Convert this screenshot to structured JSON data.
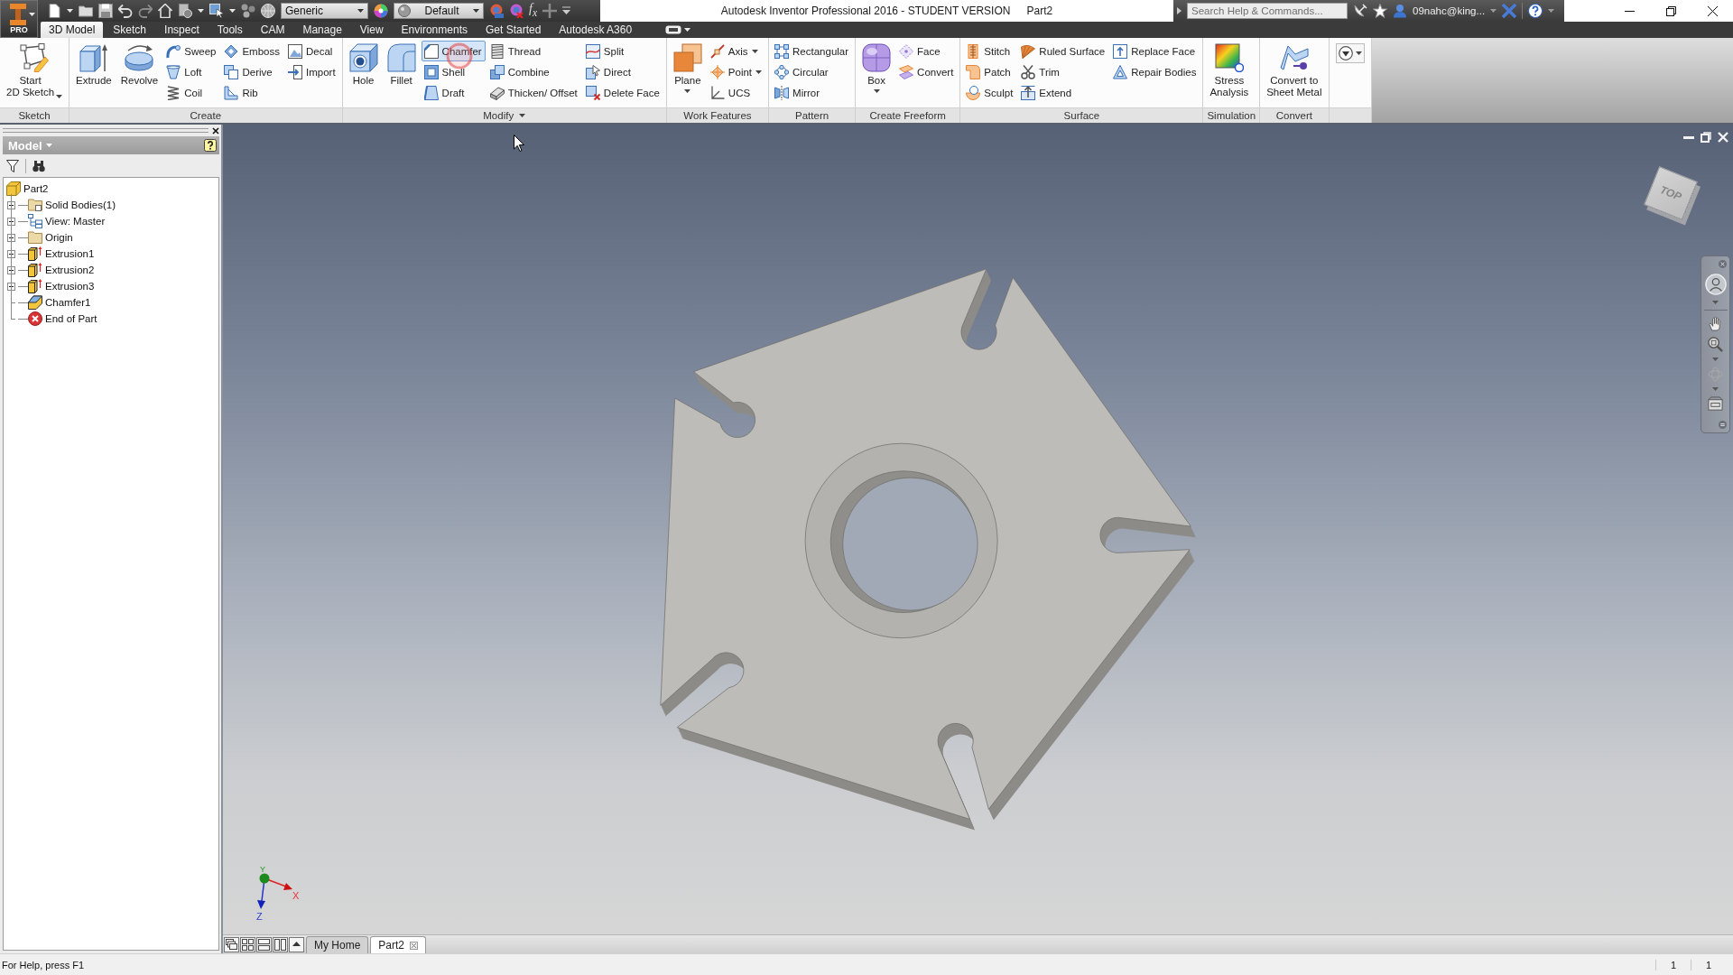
{
  "app_button": {
    "label": "PRO"
  },
  "quick_access": {
    "material": "Generic",
    "appearance": "Default",
    "function": "f$_{x}$"
  },
  "title_bar": {
    "title": "Autodesk Inventor Professional 2016 - STUDENT VERSION",
    "document": "Part2",
    "search": {
      "placeholder": "Search Help & Commands..."
    },
    "user": "09nahc@king..."
  },
  "ribbon_tabs": [
    {
      "label": "3D Model",
      "selected": true
    },
    {
      "label": "Sketch",
      "selected": false
    },
    {
      "label": "Inspect",
      "selected": false
    },
    {
      "label": "Tools",
      "selected": false
    },
    {
      "label": "CAM",
      "selected": false
    },
    {
      "label": "Manage",
      "selected": false
    },
    {
      "label": "View",
      "selected": false
    },
    {
      "label": "Environments",
      "selected": false
    },
    {
      "label": "Get Started",
      "selected": false
    },
    {
      "label": "Autodesk A360",
      "selected": false
    }
  ],
  "ribbon_panels": [
    {
      "label": "Sketch",
      "menu": false,
      "groups": [
        {
          "kind": "inline",
          "tools": [
            {
              "label": "Start\n2D Sketch",
              "dropdown": true,
              "highlighted": false
            }
          ]
        }
      ]
    },
    {
      "label": "Create",
      "menu": false,
      "groups": [
        {
          "kind": "large",
          "tools": [
            {
              "label": "Extrude",
              "dropdown": false,
              "highlighted": false
            }
          ]
        },
        {
          "kind": "large",
          "tools": [
            {
              "label": "Revolve",
              "dropdown": false,
              "highlighted": false
            }
          ]
        },
        {
          "kind": "small",
          "tools": [
            {
              "label": "Sweep",
              "dropdown": false,
              "highlighted": false
            },
            {
              "label": "Loft",
              "dropdown": false,
              "highlighted": false
            },
            {
              "label": "Coil",
              "dropdown": false,
              "highlighted": false
            }
          ]
        },
        {
          "kind": "small",
          "tools": [
            {
              "label": "Emboss",
              "dropdown": false,
              "highlighted": false
            },
            {
              "label": "Derive",
              "dropdown": false,
              "highlighted": false
            },
            {
              "label": "Rib",
              "dropdown": false,
              "highlighted": false
            }
          ]
        },
        {
          "kind": "small",
          "tools": [
            {
              "label": "Decal",
              "dropdown": false,
              "highlighted": false
            },
            {
              "label": "Import",
              "dropdown": false,
              "highlighted": false
            }
          ]
        }
      ]
    },
    {
      "label": "Modify",
      "menu": true,
      "groups": [
        {
          "kind": "large",
          "tools": [
            {
              "label": "Hole",
              "dropdown": false,
              "highlighted": false
            }
          ]
        },
        {
          "kind": "large",
          "tools": [
            {
              "label": "Fillet",
              "dropdown": false,
              "highlighted": false
            }
          ]
        },
        {
          "kind": "small",
          "tools": [
            {
              "label": "Chamfer",
              "dropdown": false,
              "highlighted": true
            },
            {
              "label": "Shell",
              "dropdown": false,
              "highlighted": false
            },
            {
              "label": "Draft",
              "dropdown": false,
              "highlighted": false
            }
          ]
        },
        {
          "kind": "small",
          "tools": [
            {
              "label": "Thread",
              "dropdown": false,
              "highlighted": false
            },
            {
              "label": "Combine",
              "dropdown": false,
              "highlighted": false
            },
            {
              "label": "Thicken/ Offset",
              "dropdown": false,
              "highlighted": false
            }
          ]
        },
        {
          "kind": "small",
          "tools": [
            {
              "label": "Split",
              "dropdown": false,
              "highlighted": false
            },
            {
              "label": "Direct",
              "dropdown": false,
              "highlighted": false
            },
            {
              "label": "Delete Face",
              "dropdown": false,
              "highlighted": false
            }
          ]
        }
      ]
    },
    {
      "label": "Work Features",
      "menu": false,
      "groups": [
        {
          "kind": "large",
          "tools": [
            {
              "label": "Plane",
              "dropdown": true,
              "highlighted": false
            }
          ]
        },
        {
          "kind": "small",
          "tools": [
            {
              "label": "Axis",
              "dropdown": true,
              "highlighted": false
            },
            {
              "label": "Point",
              "dropdown": true,
              "highlighted": false
            },
            {
              "label": "UCS",
              "dropdown": false,
              "highlighted": false
            }
          ]
        }
      ]
    },
    {
      "label": "Pattern",
      "menu": false,
      "groups": [
        {
          "kind": "small",
          "tools": [
            {
              "label": "Rectangular",
              "dropdown": false,
              "highlighted": false
            },
            {
              "label": "Circular",
              "dropdown": false,
              "highlighted": false
            },
            {
              "label": "Mirror",
              "dropdown": false,
              "highlighted": false
            }
          ]
        }
      ]
    },
    {
      "label": "Create Freeform",
      "menu": false,
      "groups": [
        {
          "kind": "large",
          "tools": [
            {
              "label": "Box",
              "dropdown": true,
              "highlighted": false
            }
          ]
        },
        {
          "kind": "small",
          "tools": [
            {
              "label": "Face",
              "dropdown": false,
              "highlighted": false
            },
            {
              "label": "Convert",
              "dropdown": false,
              "highlighted": false
            }
          ]
        }
      ]
    },
    {
      "label": "Surface",
      "menu": false,
      "groups": [
        {
          "kind": "small",
          "tools": [
            {
              "label": "Stitch",
              "dropdown": false,
              "highlighted": false
            },
            {
              "label": "Patch",
              "dropdown": false,
              "highlighted": false
            },
            {
              "label": "Sculpt",
              "dropdown": false,
              "highlighted": false
            }
          ]
        },
        {
          "kind": "small",
          "tools": [
            {
              "label": "Ruled Surface",
              "dropdown": false,
              "highlighted": false
            },
            {
              "label": "Trim",
              "dropdown": false,
              "highlighted": false
            },
            {
              "label": "Extend",
              "dropdown": false,
              "highlighted": false
            }
          ]
        },
        {
          "kind": "small",
          "tools": [
            {
              "label": "Replace Face",
              "dropdown": false,
              "highlighted": false
            },
            {
              "label": "Repair Bodies",
              "dropdown": false,
              "highlighted": false
            }
          ]
        }
      ]
    },
    {
      "label": "Simulation",
      "menu": false,
      "groups": [
        {
          "kind": "large",
          "tools": [
            {
              "label": "Stress\nAnalysis",
              "dropdown": false,
              "highlighted": false
            }
          ]
        }
      ]
    },
    {
      "label": "Convert",
      "menu": false,
      "groups": [
        {
          "kind": "large",
          "tools": [
            {
              "label": "Convert to\nSheet Metal",
              "dropdown": false,
              "highlighted": false
            }
          ]
        }
      ]
    }
  ],
  "browser": {
    "title": "Model",
    "tree": [
      {
        "label": "Part2",
        "kind": "part",
        "collapsed": false,
        "children": [
          {
            "label": "Solid Bodies(1)",
            "kind": "bodies",
            "collapsed": true
          },
          {
            "label": "View: Master",
            "kind": "view",
            "collapsed": true
          },
          {
            "label": "Origin",
            "kind": "folder",
            "collapsed": true
          },
          {
            "label": "Extrusion1",
            "kind": "extrusion",
            "collapsed": true
          },
          {
            "label": "Extrusion2",
            "kind": "extrusion",
            "collapsed": true
          },
          {
            "label": "Extrusion3",
            "kind": "extrusion",
            "collapsed": true
          },
          {
            "label": "Chamfer1",
            "kind": "chamfer",
            "collapsed": false
          },
          {
            "label": "End of Part",
            "kind": "end",
            "collapsed": false
          }
        ]
      }
    ]
  },
  "viewport": {
    "view_cube": {
      "face": "TOP"
    },
    "triad": {
      "x": "X",
      "y": "Y",
      "z": "Z"
    }
  },
  "document_tabs": [
    {
      "label": "My Home",
      "selected": false,
      "closable": false
    },
    {
      "label": "Part2",
      "selected": true,
      "closable": true
    }
  ],
  "status_bar": {
    "help": "For Help, press F1",
    "readings": [
      "1",
      "1"
    ]
  }
}
